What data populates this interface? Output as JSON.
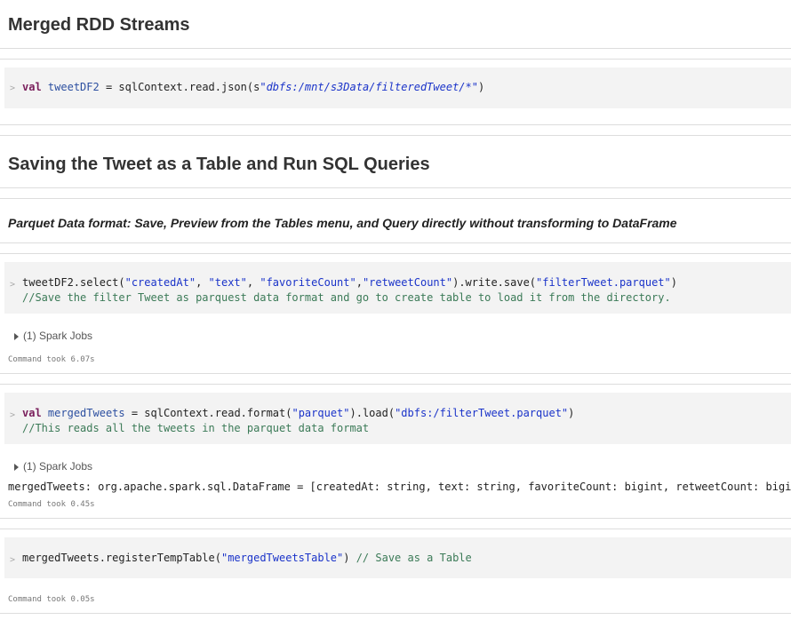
{
  "cells": {
    "h1_merged": "Merged RDD Streams",
    "code1": {
      "kw": "val",
      "var": "tweetDF2",
      "mid": " = sqlContext.read.json(s",
      "str": "\"dbfs:/mnt/s3Data/filteredTweet/*\"",
      "end": ")"
    },
    "h1_saving": "Saving the Tweet as a Table and Run SQL Queries",
    "parquet_heading": "Parquet Data format: Save, Preview from the Tables menu, and Query directly without transforming to DataFrame",
    "code2": {
      "l1_a": "tweetDF2.select(",
      "s1": "\"createdAt\"",
      "c1": ", ",
      "s2": "\"text\"",
      "c2": ", ",
      "s3": "\"favoriteCount\"",
      "c3": ",",
      "s4": "\"retweetCount\"",
      "l1_b": ").write.save(",
      "s5": "\"filterTweet.parquet\"",
      "l1_c": ")",
      "comment": "//Save the filter Tweet as parquest data format and go to create table to load it from the directory."
    },
    "jobs1": "(1) Spark Jobs",
    "time1": "Command took 6.07s",
    "code3": {
      "kw": "val",
      "var": "mergedTweets",
      "mid": " = sqlContext.read.format(",
      "s1": "\"parquet\"",
      "mid2": ").load(",
      "s2": "\"dbfs:/filterTweet.parquet\"",
      "end": ")",
      "comment": "//This reads all the tweets in the parquet data format"
    },
    "jobs2": "(1) Spark Jobs",
    "output3": "mergedTweets: org.apache.spark.sql.DataFrame = [createdAt: string, text: string, favoriteCount: bigint, retweetCount: bigint]",
    "time3": "Command took 0.45s",
    "code4": {
      "a": "mergedTweets.registerTempTable(",
      "s": "\"mergedTweetsTable\"",
      "b": ") ",
      "comment": "// Save as a Table"
    },
    "time4": "Command took 0.05s"
  },
  "prompt_symbol": ">"
}
